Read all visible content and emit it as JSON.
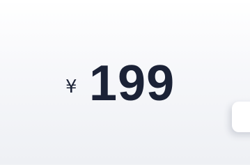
{
  "price": {
    "currency_symbol": "¥",
    "amount": "199"
  }
}
